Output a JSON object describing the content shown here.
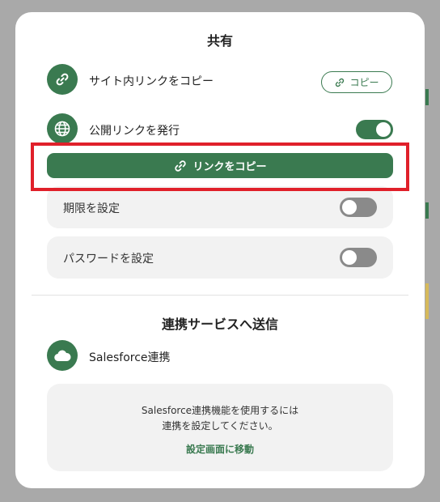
{
  "modal": {
    "title": "共有",
    "internal_link": {
      "label": "サイト内リンクをコピー",
      "copy_button": "コピー"
    },
    "public_link": {
      "label": "公開リンクを発行",
      "enabled": true
    },
    "copy_link_button": "リンクをコピー",
    "settings": [
      {
        "label": "期限を設定",
        "enabled": false
      },
      {
        "label": "パスワードを設定",
        "enabled": false
      }
    ],
    "integration": {
      "title": "連携サービスへ送信",
      "salesforce_label": "Salesforce連携",
      "info_line1": "Salesforce連携機能を使用するには",
      "info_line2": "連携を設定してください。",
      "settings_link": "設定画面に移動"
    }
  },
  "colors": {
    "accent": "#3a7a50",
    "highlight": "#e0202a"
  },
  "icons": [
    "link-icon",
    "globe-icon",
    "cloud-icon"
  ]
}
